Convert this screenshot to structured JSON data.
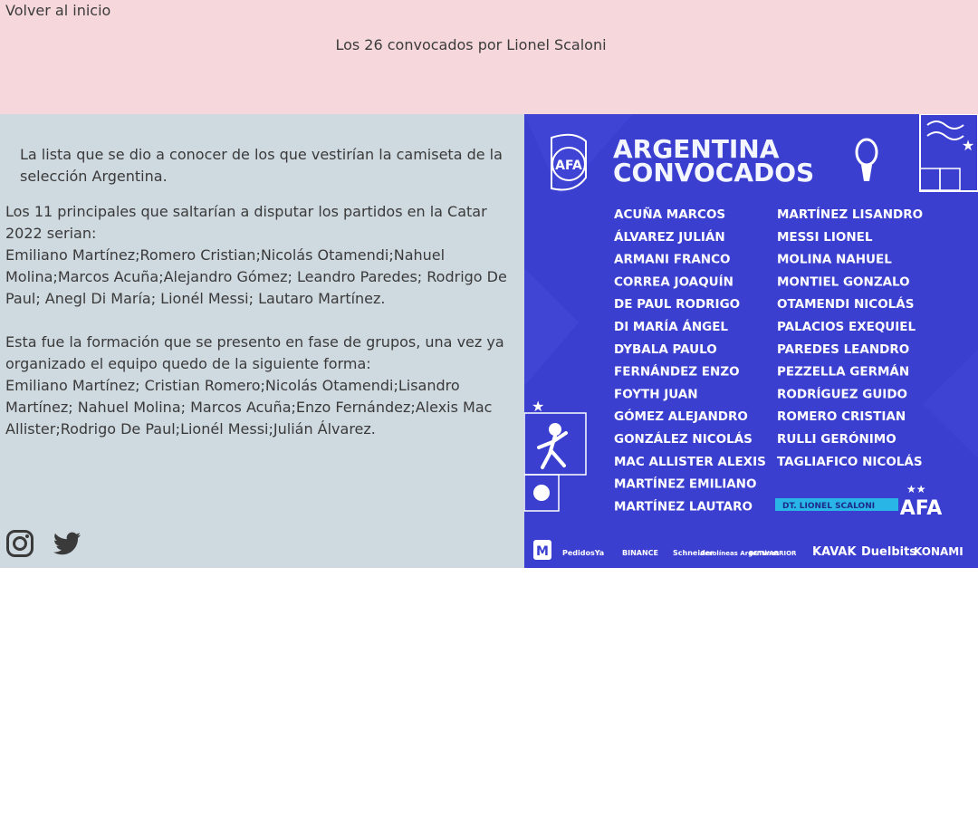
{
  "header": {
    "back_link": "Volver al inicio",
    "title": "Los 26 convocados por Lionel Scaloni"
  },
  "content": {
    "intro": "La lista que se dio a conocer de los que vestirían la camiseta de la selección Argentina.",
    "paragraph1_lines": [
      "Los 11 principales que saltarían a disputar los partidos en la Catar 2022 serian:",
      "Emiliano Martínez;Romero Cristian;Nicolás Otamendi;Nahuel Molina;Marcos Acuña;Alejandro Gómez; Leandro Paredes; Rodrigo De Paul; Anegl Di María; Lionél Messi; Lautaro Martínez."
    ],
    "paragraph2_lines": [
      "Esta fue la formación que se presento en fase de grupos, una vez ya organizado el equipo quedo de la siguiente forma:",
      "Emiliano Martínez; Cristian Romero;Nicolás Otamendi;Lisandro Martínez; Nahuel Molina; Marcos Acuña;Enzo Fernández;Alexis Mac Allister;Rodrigo De Paul;Lionél Messi;Julián Álvarez."
    ]
  },
  "social": {
    "items": [
      {
        "icon": "instagram-icon"
      },
      {
        "icon": "twitter-icon"
      }
    ]
  },
  "poster": {
    "background": "#3a3fd0",
    "title_line1": "ARGENTINA",
    "title_line2": "CONVOCADOS",
    "badge_text": "AFA",
    "coach_label": "DT. LIONEL SCALONI",
    "players_left": [
      "ACUÑA MARCOS",
      "ÁLVAREZ JULIÁN",
      "ARMANI FRANCO",
      "CORREA JOAQUÍN",
      "DE PAUL RODRIGO",
      "DI MARÍA ÁNGEL",
      "DYBALA PAULO",
      "FERNÁNDEZ ENZO",
      "FOYTH JUAN",
      "GÓMEZ ALEJANDRO",
      "GONZÁLEZ NICOLÁS",
      "MAC ALLISTER ALEXIS",
      "MARTÍNEZ EMILIANO",
      "MARTÍNEZ LAUTARO"
    ],
    "players_right": [
      "MARTÍNEZ LISANDRO",
      "MESSI LIONEL",
      "MOLINA NAHUEL",
      "MONTIEL GONZALO",
      "OTAMENDI NICOLÁS",
      "PALACIOS EXEQUIEL",
      "PAREDES LEANDRO",
      "PEZZELLA GERMÁN",
      "RODRÍGUEZ GUIDO",
      "ROMERO CRISTIAN",
      "RULLI GERÓNIMO",
      "TAGLIAFICO NICOLÁS"
    ],
    "sponsors": [
      "PedidosYa",
      "BINANCE",
      "Schneider",
      "Aerolíneas Argentinas",
      "BETWARRIOR",
      "KAVAK",
      "Duelbits",
      "KONAMI"
    ]
  }
}
